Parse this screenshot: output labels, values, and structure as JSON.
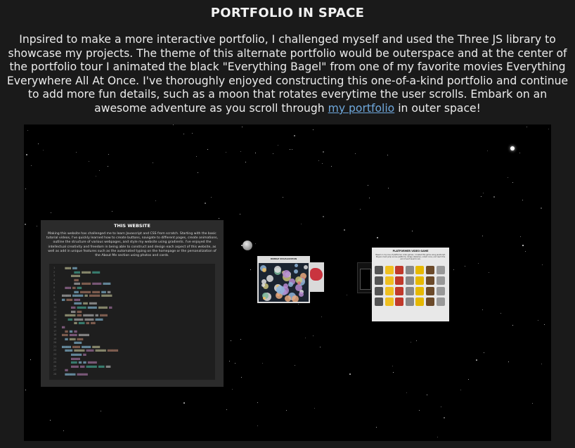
{
  "page": {
    "title": "PORTFOLIO IN SPACE",
    "description_before_link": "Inpsired to make a more interactive portfolio, I challenged myself and used the Three JS library to showcase my projects. The theme of this alternate portfolio would be outerspace and at the center of the portfolio tour I animated the black \"Everything Bagel\" from one of my favorite movies Everything Everywhere All At Once. I've thoroughly enjoyed constructing this one-of-a-kind portfolio and continue to add more fun details, such as a moon that rotates everytime the user scrolls. Embark on an awesome adventure as you scroll through",
    "link_text": "my portfolio",
    "description_after_link": "in outer space!"
  },
  "scene": {
    "main_card": {
      "title": "THIS WEBSITE",
      "text": "Making this website has challenged me to learn Javascript and CSS from scratch. Starting with the basic tutorial videos, I've quickly learned how to create buttons, navigate to different pages, create animations, outline the structure of various webpages, and style my website using gradients. I've enjoyed the intellectual creativity and freedom in being able to construct and design each aspect of this website, as well as add in unique features such as the automated typing on the homepage or the personalization of the About Me section using photos and cards."
    },
    "mid_card_title": "BUBBLE VISUALIZATION",
    "right_card": {
      "title": "PLATFORMER VIDEO GAME",
      "text": "Based on my love of platformer video games, I created this game using JavaScript. Players must jump across platforms, dodge obstacles, collect coins, and reach the end of each level to win."
    }
  }
}
